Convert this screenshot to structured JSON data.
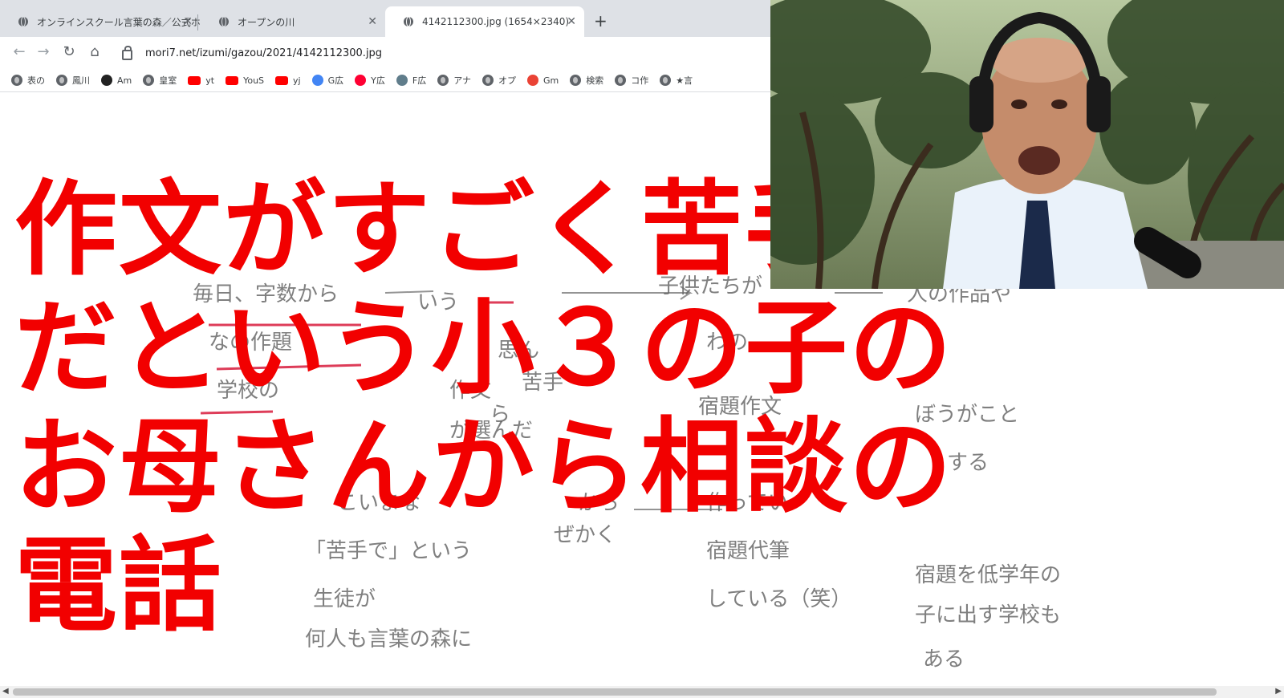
{
  "browser": {
    "tabs": [
      {
        "title": "オンラインスクール言葉の森／公式ホ",
        "close": "✕"
      },
      {
        "title": "オープンの川",
        "close": "✕"
      },
      {
        "title": "4142112300.jpg (1654×2340)",
        "close": "✕"
      }
    ],
    "new_tab": "+",
    "nav": {
      "back": "←",
      "forward": "→",
      "reload": "↻",
      "home": "⌂"
    },
    "url": "mori7.net/izumi/gazou/2021/4142112300.jpg",
    "bookmarks": [
      {
        "label": "表の",
        "icon": "globe-icon"
      },
      {
        "label": "鳳川",
        "icon": "globe-icon"
      },
      {
        "label": "Am",
        "icon": "amazon-icon"
      },
      {
        "label": "皇室",
        "icon": "globe-icon"
      },
      {
        "label": "yt",
        "icon": "youtube-icon"
      },
      {
        "label": "YouS",
        "icon": "youtube-icon"
      },
      {
        "label": "yj",
        "icon": "youtube-icon"
      },
      {
        "label": "G広",
        "icon": "google-ads-icon"
      },
      {
        "label": "Y広",
        "icon": "yahoo-icon"
      },
      {
        "label": "F広",
        "icon": "image-icon"
      },
      {
        "label": "アナ",
        "icon": "globe-icon"
      },
      {
        "label": "オプ",
        "icon": "globe-icon"
      },
      {
        "label": "Gm",
        "icon": "gmail-icon"
      },
      {
        "label": "検索",
        "icon": "globe-icon"
      },
      {
        "label": "コ作",
        "icon": "globe-icon"
      },
      {
        "label": "★言",
        "icon": "globe-icon"
      }
    ]
  },
  "headline": "作文がすごく苦手\nだという小３の子の\nお母さんから相談の\n電話",
  "handwriting": [
    "毎日、字数から",
    "いう",
    "子供たちが",
    "人の作品や",
    "なの作題",
    "思ん",
    "わの",
    "苦手",
    "学校の",
    "作文",
    "が選んだ",
    "ら",
    "宿題作文",
    "ぼうがこと",
    "する",
    "こいまな",
    "から",
    "作ってい",
    "「苦手で」という",
    "宿題代筆",
    "生徒が",
    "している（笑）",
    "何人も言葉の森に",
    "宿題を低学年の",
    "子に出す学校も",
    "ある",
    "ぜかく"
  ],
  "colors": {
    "headline": "#f20000",
    "accent_underline": "#d81b3c"
  }
}
